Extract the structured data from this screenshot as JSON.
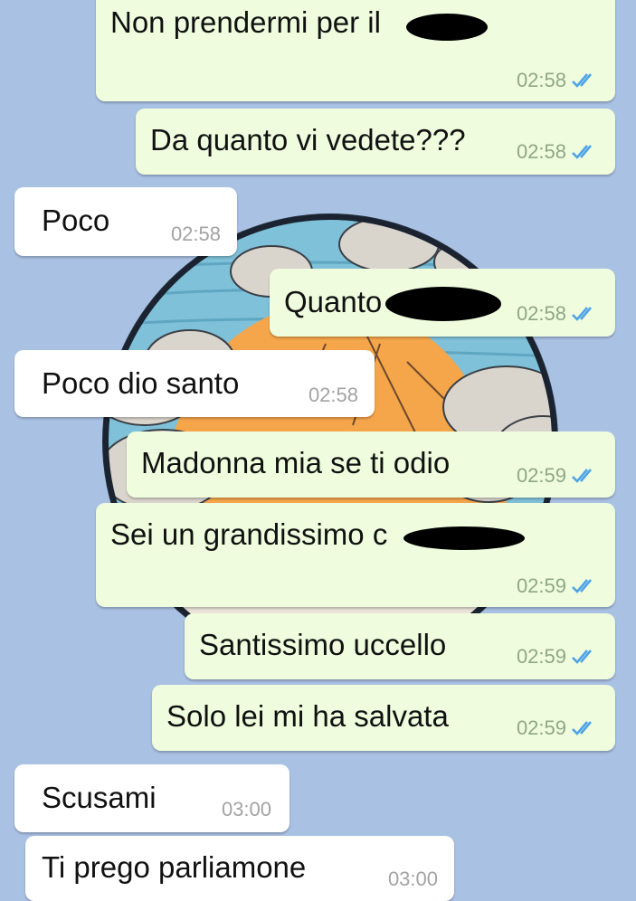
{
  "colors": {
    "background": "#a9c1e3",
    "outgoing_bubble": "#effdde",
    "incoming_bubble": "#ffffff",
    "tick_color": "#4fa3e8"
  },
  "messages": [
    {
      "dir": "out",
      "text": "Non prendermi per il",
      "time": "02:58",
      "status": "read-double-check-icon"
    },
    {
      "dir": "out",
      "text": "Da quanto vi vedete???",
      "time": "02:58",
      "status": "read-double-check-icon"
    },
    {
      "dir": "in",
      "text": "Poco",
      "time": "02:58"
    },
    {
      "dir": "out",
      "text": "Quanto",
      "time": "02:58",
      "status": "read-double-check-icon"
    },
    {
      "dir": "in",
      "text": "Poco dio santo",
      "time": "02:58"
    },
    {
      "dir": "out",
      "text": "Madonna mia se ti odio",
      "time": "02:59",
      "status": "read-double-check-icon"
    },
    {
      "dir": "out",
      "text": "Sei un grandissimo c",
      "time": "02:59",
      "status": "read-double-check-icon"
    },
    {
      "dir": "out",
      "text": "Santissimo uccello",
      "time": "02:59",
      "status": "read-double-check-icon"
    },
    {
      "dir": "out",
      "text": "Solo lei mi ha salvata",
      "time": "02:59",
      "status": "read-double-check-icon"
    },
    {
      "dir": "in",
      "text": "Scusami",
      "time": "03:00"
    },
    {
      "dir": "in",
      "text": "Ti prego parliamone",
      "time": "03:00"
    }
  ]
}
